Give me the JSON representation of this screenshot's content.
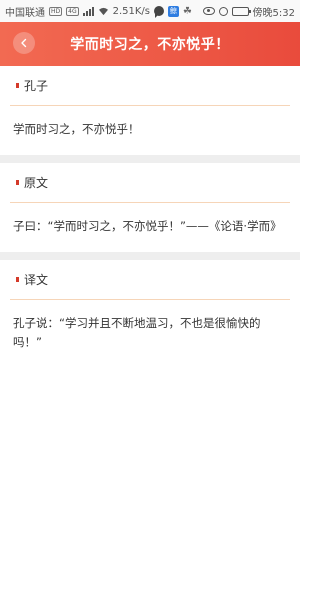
{
  "status_bar": {
    "carrier": "中国联通",
    "hd_label": "HD",
    "net_label": "4G",
    "speed": "2.51K/s",
    "app_badge": "鲸",
    "time": "傍晚5:32"
  },
  "header": {
    "title": "学而时习之，不亦悦乎！"
  },
  "sections": [
    {
      "title": "孔子",
      "body": "学而时习之，不亦悦乎！"
    },
    {
      "title": "原文",
      "body": "子曰：“学而时习之，不亦悦乎！”——《论语·学而》"
    },
    {
      "title": "译文",
      "body": "孔子说：“学习并且不断地温习，不也是很愉快的吗！”"
    }
  ],
  "colors": {
    "header_start": "#f26a52",
    "header_end": "#e94b3c",
    "marker": "#d43a2a",
    "divider_line": "#f6d5b8"
  },
  "icons": [
    "back-arrow-icon",
    "signal-icon",
    "wifi-icon",
    "chat-icon",
    "eye-icon",
    "alarm-icon",
    "battery-icon"
  ]
}
